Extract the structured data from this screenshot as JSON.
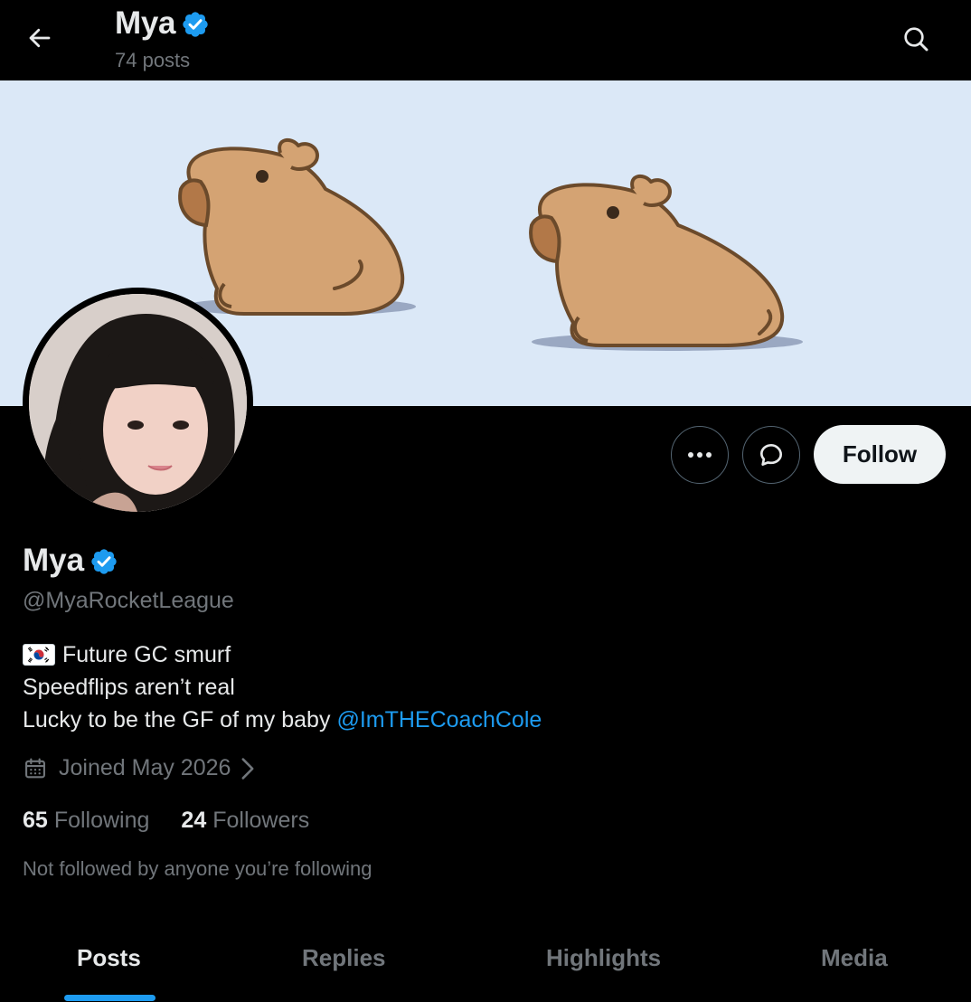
{
  "header": {
    "name": "Mya",
    "posts_count": "74 posts",
    "back_icon": "back-arrow-icon",
    "search_icon": "search-icon"
  },
  "colors": {
    "background": "#000000",
    "text": "#e7e9ea",
    "muted": "#71767b",
    "accent": "#1d9bf0",
    "banner": "#dbe8f7",
    "follow_bg": "#eff3f4"
  },
  "banner": {
    "image": "two cartoon capybaras on light blue background"
  },
  "actions": {
    "more_icon": "more-dots-icon",
    "message_icon": "chat-bubble-icon",
    "follow_label": "Follow"
  },
  "profile": {
    "display_name": "Mya",
    "handle": "@MyaRocketLeague",
    "bio": {
      "line1": "Future GC smurf",
      "line2": "Speedflips aren’t real",
      "line3": "Lucky to be the GF of my baby",
      "mention": "@ImTHECoachCole"
    },
    "joined": "Joined May 2026",
    "following_count": "65",
    "following_label": "Following",
    "followers_count": "24",
    "followers_label": "Followers",
    "not_followed": "Not followed by anyone you’re following"
  },
  "tabs": [
    {
      "label": "Posts",
      "active": true
    },
    {
      "label": "Replies",
      "active": false
    },
    {
      "label": "Highlights",
      "active": false
    },
    {
      "label": "Media",
      "active": false
    }
  ]
}
